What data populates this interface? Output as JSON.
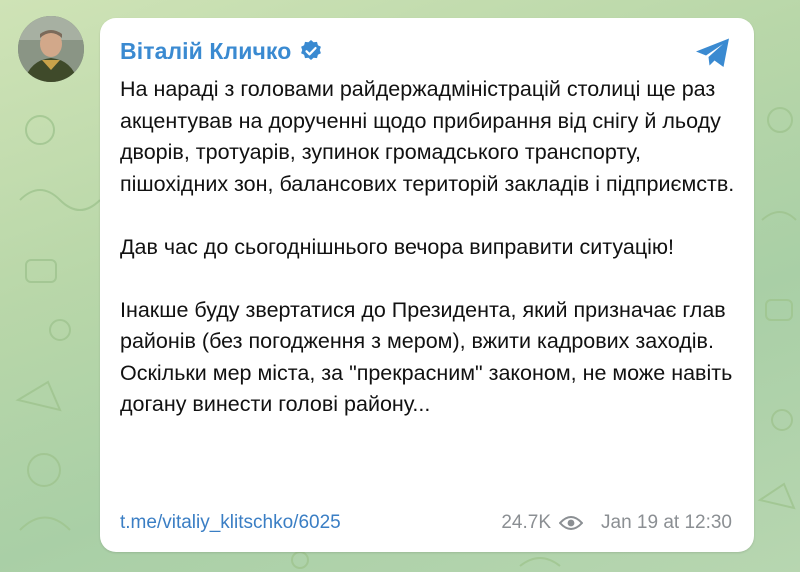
{
  "post": {
    "author": "Віталій Кличко",
    "paragraphs": [
      "На нараді з головами райдержадміністрацій столиці ще раз акцентував на дорученні щодо прибирання від снігу й льоду дворів, тротуарів, зупинок громадського транспорту, пішохідних зон, балансових територій закладів і підприємств.",
      "Дав час до сьогоднішнього вечора виправити ситуацію!",
      "Інакше буду звертатися до Президента, який призначає глав районів (без погодження з мером), вжити кадрових заходів. Оскільки мер міста, за \"прекрасним\" законом, не може навіть догану винести голові району..."
    ],
    "link": "t.me/vitaliy_klitschko/6025",
    "views": "24.7K",
    "timestamp": "Jan 19 at 12:30"
  },
  "icons": {
    "verified": "verified-badge-icon",
    "share": "telegram-share-icon",
    "views": "eye-icon"
  },
  "colors": {
    "accent": "#3a8ad1",
    "link": "#3a7ec4",
    "meta": "#8b8f93",
    "background": "#b9d7a9"
  }
}
